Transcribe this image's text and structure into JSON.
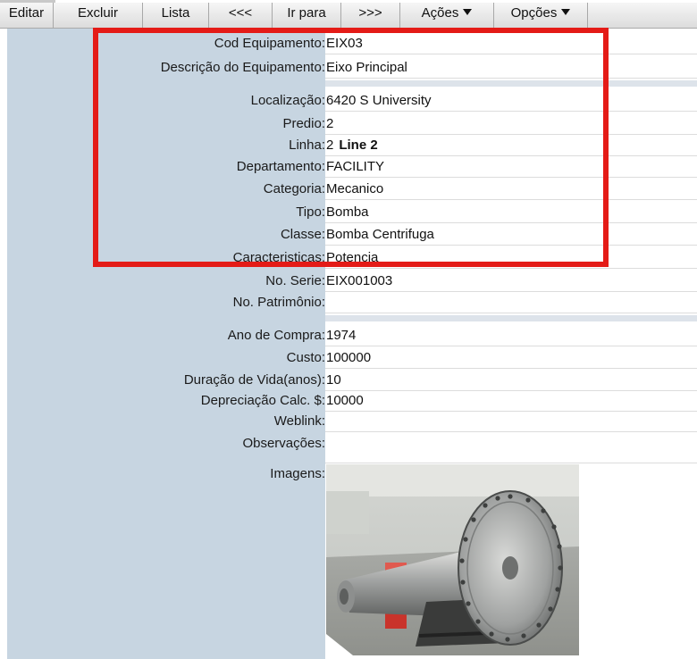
{
  "toolbar": {
    "edit": "Editar",
    "delete": "Excluir",
    "list": "Lista",
    "prev": "<<<",
    "goto": "Ir para",
    "next": ">>>",
    "actions": "Ações",
    "options": "Opções"
  },
  "fields": {
    "cod_equipamento": {
      "label": "Cod Equipamento:",
      "value": "EIX03"
    },
    "descricao": {
      "label": "Descrição do Equipamento:",
      "value": "Eixo Principal"
    },
    "localizacao": {
      "label": "Localização:",
      "value": "6420 S University"
    },
    "predio": {
      "label": "Predio:",
      "value": "2"
    },
    "linha": {
      "label": "Linha:",
      "value": "2",
      "value_bold": "Line 2"
    },
    "departamento": {
      "label": "Departamento:",
      "value": "FACILITY"
    },
    "categoria": {
      "label": "Categoria:",
      "value": "Mecanico"
    },
    "tipo": {
      "label": "Tipo:",
      "value": "Bomba"
    },
    "classe": {
      "label": "Classe:",
      "value": "Bomba Centrifuga"
    },
    "caracteristicas": {
      "label": "Caracteristicas:",
      "value": "Potencia"
    },
    "no_serie": {
      "label": "No. Serie:",
      "value": "EIX001003"
    },
    "no_patrimonio": {
      "label": "No. Patrimônio:",
      "value": ""
    },
    "ano_compra": {
      "label": "Ano de Compra:",
      "value": "1974"
    },
    "custo": {
      "label": "Custo:",
      "value": "100000"
    },
    "duracao_vida": {
      "label": "Duração de Vida(anos):",
      "value": "10"
    },
    "depreciacao": {
      "label": "Depreciação Calc. $:",
      "value": "10000"
    },
    "weblink": {
      "label": "Weblink:",
      "value": ""
    },
    "observacoes": {
      "label": "Observações:",
      "value": ""
    },
    "imagens": {
      "label": "Imagens:"
    }
  },
  "colors": {
    "label_column": "#c7d5e1",
    "highlight_border": "#e41b17"
  }
}
